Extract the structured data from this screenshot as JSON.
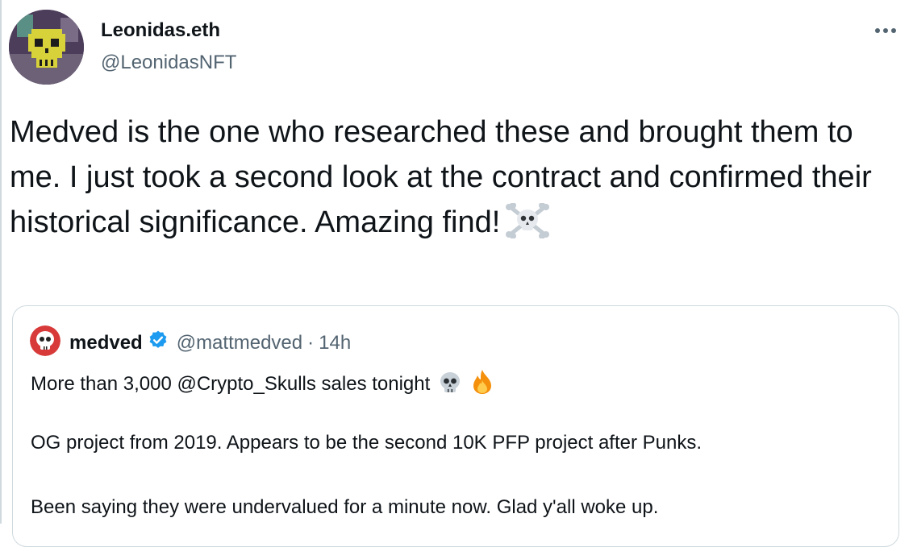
{
  "tweet": {
    "author": {
      "display_name": "Leonidas.eth",
      "handle": "@LeonidasNFT",
      "avatar": "skull-avatar"
    },
    "more_icon": "more-horizontal-icon",
    "text": "Medved is the one who researched these and brought them to me. I just took a second look at the contract and confirmed their historical significance. Amazing find!",
    "text_emoji": "skull-crossbones-icon"
  },
  "quote": {
    "author": {
      "display_name": "medved",
      "handle": "@mattmedved",
      "separator": "·",
      "time": "14h",
      "avatar": "skull-avatar",
      "verified_icon": "verified-badge-icon"
    },
    "lines": [
      "More than 3,000 @Crypto_Skulls sales tonight",
      "OG project from 2019. Appears to be the second 10K PFP project after Punks.",
      "Been saying they were undervalued for a minute now. Glad y'all woke up."
    ],
    "line1_emojis": [
      "skull-icon",
      "fire-icon"
    ]
  },
  "colors": {
    "text": "#0f1419",
    "secondary": "#536471",
    "border": "#cfd9de",
    "verified": "#1d9bf0"
  }
}
